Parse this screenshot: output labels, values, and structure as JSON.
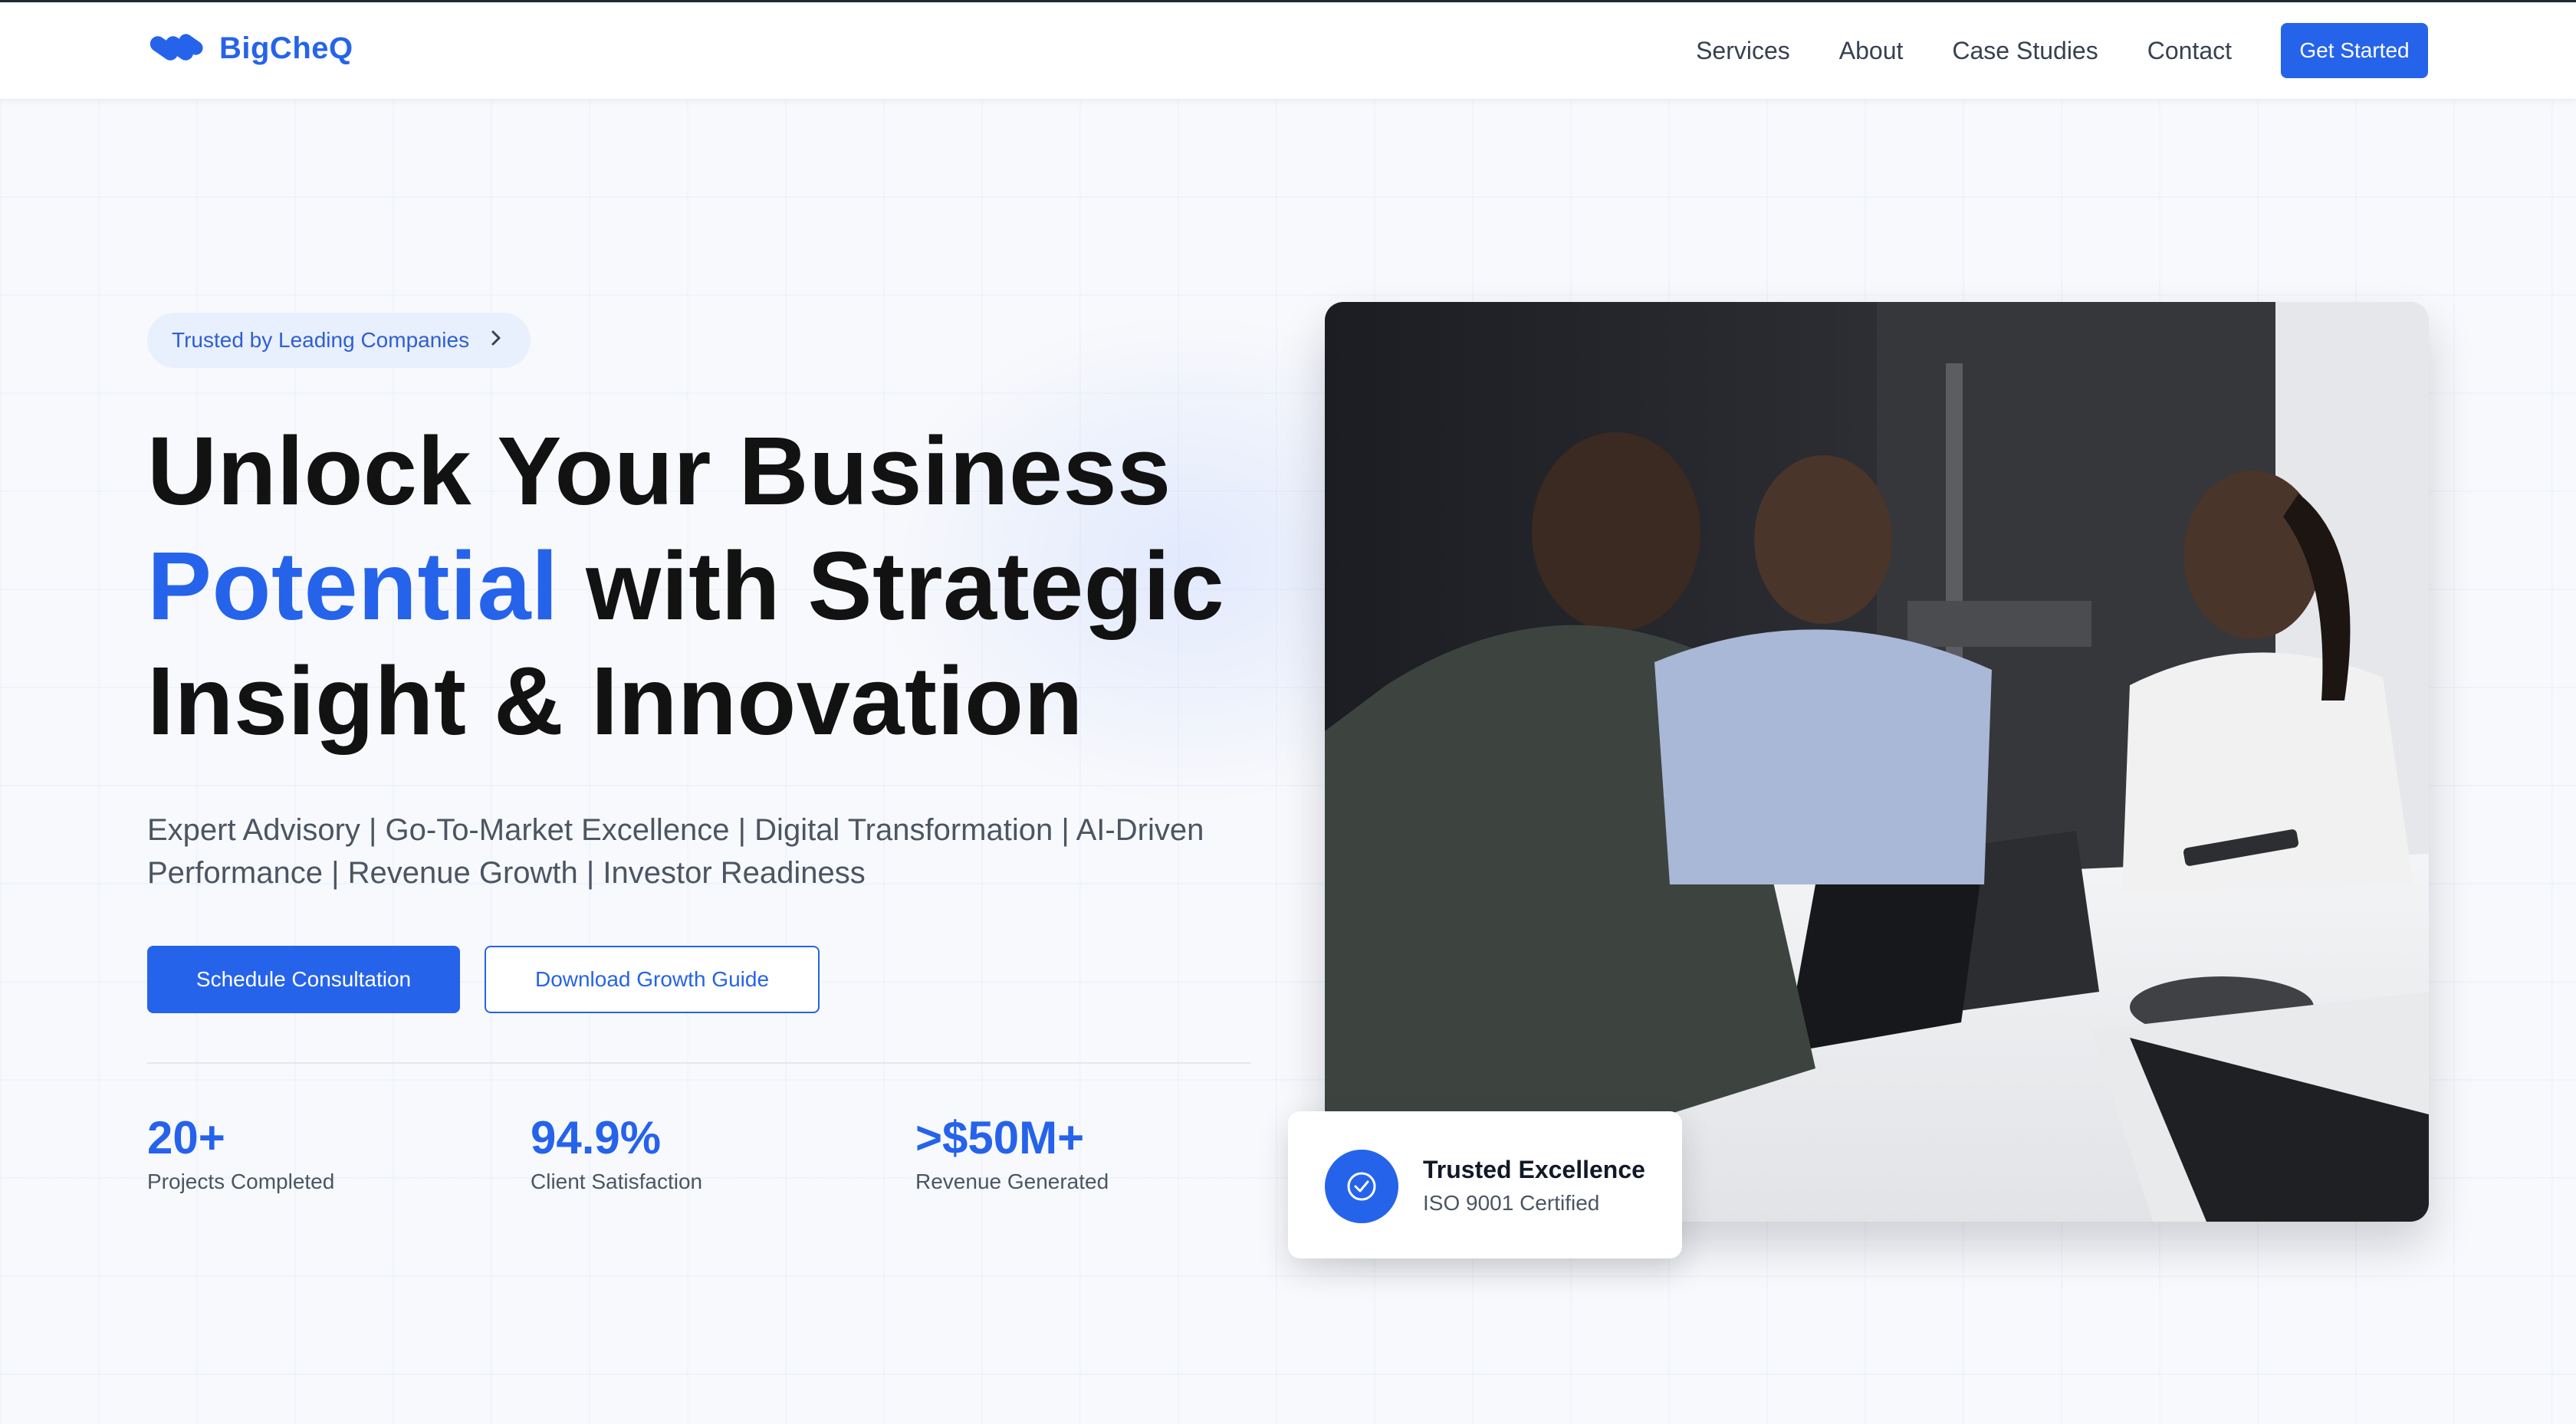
{
  "brand": {
    "name": "BigCheQ",
    "logo_icon": "bigcheq-logo-icon",
    "accent_color": "#2563eb"
  },
  "nav": {
    "items": [
      {
        "label": "Services"
      },
      {
        "label": "About"
      },
      {
        "label": "Case Studies"
      },
      {
        "label": "Contact"
      }
    ],
    "cta_label": "Get Started"
  },
  "hero": {
    "badge_label": "Trusted by Leading Companies",
    "badge_icon": "chevron-right-icon",
    "headline_line1": "Unlock Your Business",
    "headline_accent": "Potential",
    "headline_line2_rest": " with Strategic",
    "headline_line3": "Insight & Innovation",
    "subheading": "Expert Advisory | Go-To-Market Excellence | Digital Transformation | AI-Driven Performance | Revenue Growth | Investor Readiness",
    "primary_cta": "Schedule Consultation",
    "secondary_cta": "Download Growth Guide",
    "stats": [
      {
        "value": "20+",
        "label": "Projects Completed"
      },
      {
        "value": "94.9%",
        "label": "Client Satisfaction"
      },
      {
        "value": ">$50M+",
        "label": "Revenue Generated"
      }
    ]
  },
  "trust_card": {
    "icon": "check-circle-icon",
    "title": "Trusted Excellence",
    "subtitle": "ISO 9001 Certified"
  }
}
